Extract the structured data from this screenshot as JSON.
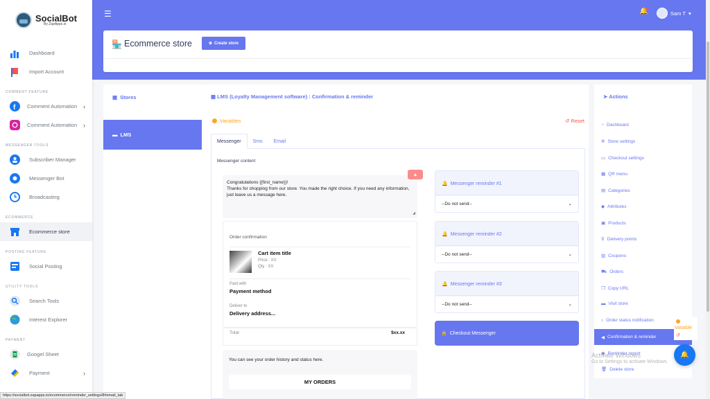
{
  "app": {
    "logo_name": "SocialBot",
    "logo_sub": "By ZapApps.io",
    "user_name": "Sam T",
    "status_url": "https://socialbot.zapapps.io/ecommerce/reminder_settings/8#email_tab"
  },
  "sidebar": {
    "items": [
      {
        "label": "Dashboard",
        "icon": "bar-chart-icon"
      },
      {
        "label": "Import Account",
        "icon": "flag-icon"
      }
    ],
    "section_comment": "COMMENT FEATURE",
    "comment_items": [
      {
        "label": "Comment Automation",
        "icon": "facebook-icon"
      },
      {
        "label": "Comment Automation",
        "icon": "instagram-icon"
      }
    ],
    "section_messenger": "MESSENGER TOOLS",
    "messenger_items": [
      {
        "label": "Subscriber Manager",
        "icon": "users-icon"
      },
      {
        "label": "Messenger Bot",
        "icon": "gear-icon"
      },
      {
        "label": "Broadcasting",
        "icon": "clock-icon"
      }
    ],
    "section_ecommerce": "ECOMMERCE",
    "ecommerce_items": [
      {
        "label": "Ecommerce store",
        "icon": "store-icon"
      }
    ],
    "section_posting": "POSTING FEATURE",
    "posting_items": [
      {
        "label": "Social Posting",
        "icon": "social-posting-icon"
      }
    ],
    "section_utility": "UTILITY TOOLS",
    "utility_items": [
      {
        "label": "Search Tools",
        "icon": "search-icon"
      },
      {
        "label": "Interest Explorer",
        "icon": "globe-icon"
      }
    ],
    "section_payment": "PAYMENT",
    "payment_items": [
      {
        "label": "Googel Sheet",
        "icon": "google-sheet-icon"
      },
      {
        "label": "Payment",
        "icon": "payment-icon"
      }
    ]
  },
  "header": {
    "title": "Ecommerce store",
    "create_label": "Create store"
  },
  "left_panel": {
    "stores_label": "Stores",
    "lms_label": "LMS"
  },
  "main": {
    "title": "LMS (Loyalty Management software) : Confirmation & reminder",
    "variables_label": "Variables",
    "reset_label": "Reset",
    "tabs": [
      {
        "label": "Messenger",
        "active": true
      },
      {
        "label": "Sms",
        "active": false
      },
      {
        "label": "Email",
        "active": false
      }
    ],
    "content_label": "Messenger content",
    "message_line1": "Congratulations {{first_name}}!",
    "message_line2": "Thanks for shopping from our store. You made the right choice. If you need any information, just leave us a message here.",
    "order": {
      "title": "Order confirmation",
      "item_title": "Cart item title",
      "item_price": "Price : XX",
      "item_qty": "Qty : XX",
      "paid_label": "Paid with",
      "paid_value": "Payment method",
      "deliver_label": "Deliver to",
      "deliver_value": "Delivery address...",
      "total_label": "Total",
      "total_value": "$xx.xx"
    },
    "history_text": "You can see your order history and status here.",
    "my_orders_label": "MY ORDERS",
    "reminders": [
      {
        "title": "Messenger reminder #1",
        "selected": "--Do not send--"
      },
      {
        "title": "Messenger reminder #2",
        "selected": "--Do not send--"
      },
      {
        "title": "Messenger reminder #3",
        "selected": "--Do not send--"
      }
    ],
    "checkout_label": "Checkout Messenger"
  },
  "actions": {
    "title": "Actions",
    "items": [
      {
        "label": "Dashboard",
        "icon": "dashboard-icon"
      },
      {
        "label": "Store settings",
        "icon": "gear-icon"
      },
      {
        "label": "Checkout settings",
        "icon": "checkout-icon"
      },
      {
        "label": "QR menu",
        "icon": "qr-icon"
      },
      {
        "label": "Categories",
        "icon": "categories-icon"
      },
      {
        "label": "Attributes",
        "icon": "attributes-icon"
      },
      {
        "label": "Products",
        "icon": "products-icon"
      },
      {
        "label": "Delivery points",
        "icon": "map-pin-icon"
      },
      {
        "label": "Coupons",
        "icon": "coupon-icon"
      },
      {
        "label": "Orders",
        "icon": "cart-icon"
      },
      {
        "label": "Copy URL",
        "icon": "copy-icon"
      },
      {
        "label": "Visit store",
        "icon": "store-icon"
      },
      {
        "label": "Order status notification",
        "icon": "bell-icon"
      },
      {
        "label": "Confirmation & reminder",
        "icon": "megaphone-icon",
        "active": true
      },
      {
        "label": "Reminder report",
        "icon": "report-icon"
      },
      {
        "label": "Delete store",
        "icon": "trash-icon"
      }
    ]
  },
  "floating": {
    "variables_label": "Variable",
    "watermark_line1": "Activate Windows",
    "watermark_line2": "Go to Settings to activate Windows."
  },
  "colors": {
    "primary": "#6777ef",
    "warning": "#ffa426",
    "danger": "#fc544b"
  }
}
